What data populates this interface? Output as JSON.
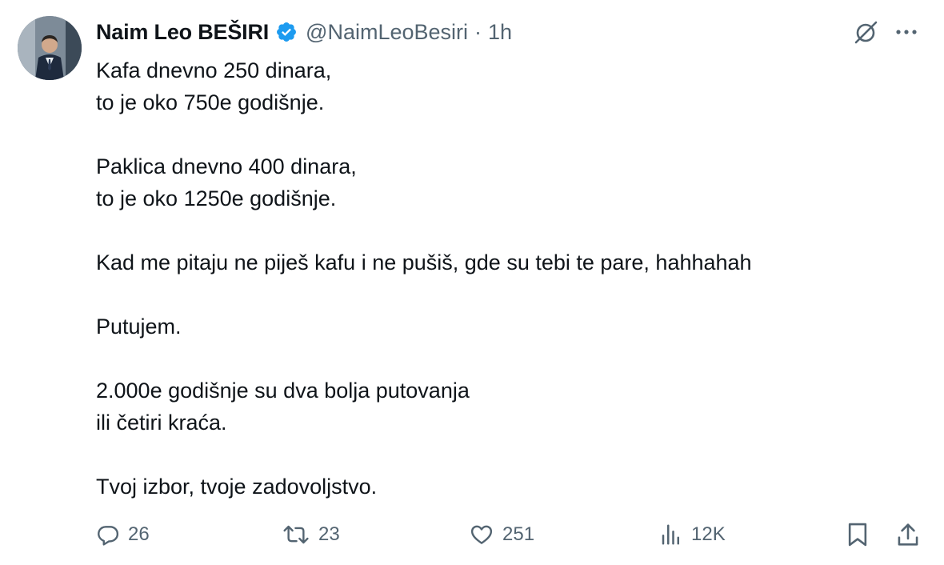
{
  "author": {
    "name": "Naim Leo BEŠIRI",
    "handle": "@NaimLeoBesiri",
    "separator": "·",
    "time": "1h",
    "verified_color": "#1d9bf0"
  },
  "body": {
    "lines": [
      "Kafa dnevno 250 dinara,",
      "to je oko 750e godišnje.",
      "",
      "Paklica dnevno 400 dinara,",
      "to je oko 1250e godišnje.",
      "",
      "Kad me pitaju ne piješ kafu i ne pušiš, gde su tebi te pare, hahhahah",
      "",
      "Putujem.",
      "",
      "2.000e godišnje su dva bolja putovanja",
      "ili četiri kraća.",
      "",
      "Tvoj izbor, tvoje zadovoljstvo."
    ]
  },
  "actions": {
    "replies": "26",
    "reposts": "23",
    "likes": "251",
    "views": "12K"
  },
  "icons": {
    "avatar": "profile-photo",
    "verified": "verified-badge-icon",
    "grok": "grok-icon",
    "more": "more-icon",
    "reply": "reply-icon",
    "repost": "repost-icon",
    "like": "heart-icon",
    "views": "views-chart-icon",
    "bookmark": "bookmark-icon",
    "share": "share-icon"
  },
  "colors": {
    "text": "#0f1419",
    "secondary": "#536471",
    "accent": "#1d9bf0"
  }
}
